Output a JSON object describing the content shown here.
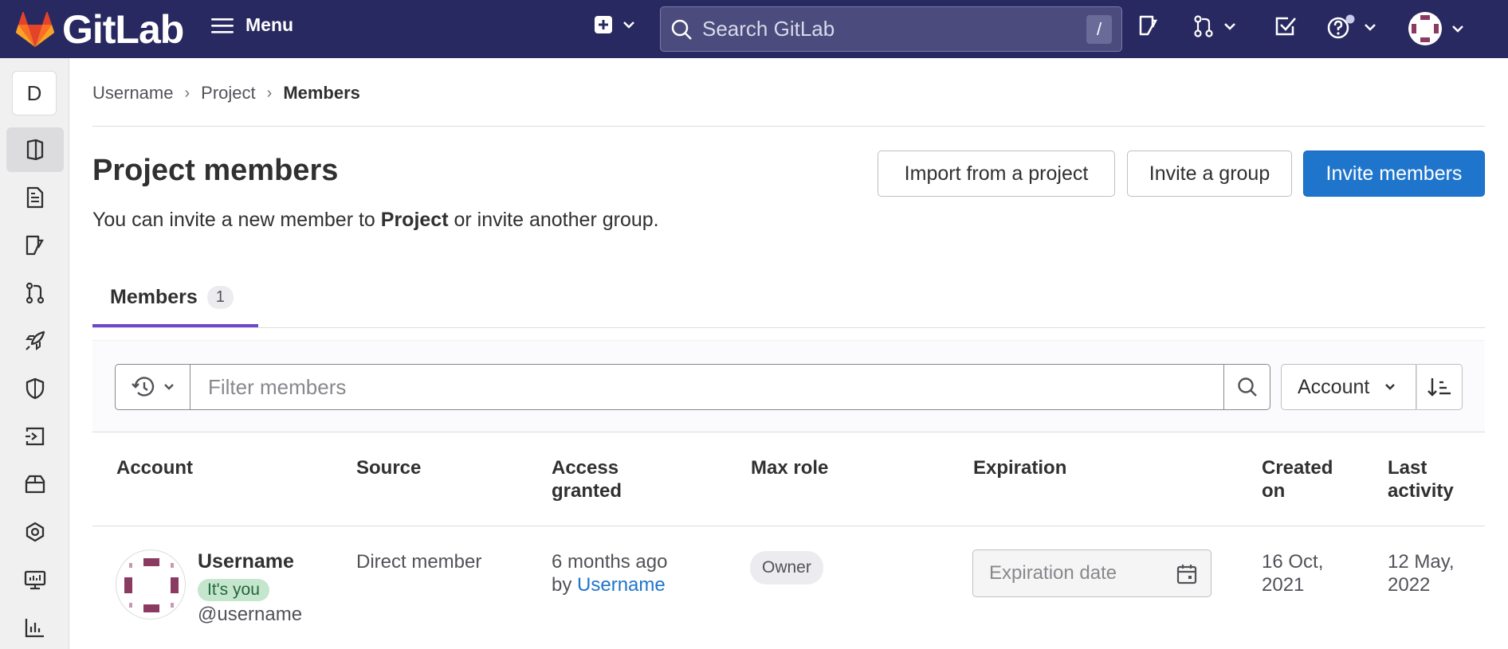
{
  "topbar": {
    "brand": "GitLab",
    "menu_label": "Menu",
    "search_placeholder": "Search GitLab",
    "search_shortcut": "/"
  },
  "sidebar": {
    "project_initial": "D",
    "items": [
      "project-overview",
      "repository",
      "issues",
      "merge-requests",
      "ci-cd",
      "security",
      "deployments",
      "packages",
      "infrastructure",
      "monitor",
      "analytics"
    ]
  },
  "breadcrumb": [
    "Username",
    "Project",
    "Members"
  ],
  "header": {
    "title": "Project members",
    "description_prefix": "You can invite a new member to ",
    "description_project": "Project",
    "description_suffix": " or invite another group."
  },
  "actions": {
    "import": "Import from a project",
    "invite_group": "Invite a group",
    "invite_members": "Invite members"
  },
  "tabs": [
    {
      "label": "Members",
      "count": "1"
    }
  ],
  "filter": {
    "placeholder": "Filter members",
    "sort_by": "Account"
  },
  "table": {
    "columns": [
      "Account",
      "Source",
      "Access granted",
      "Max role",
      "Expiration",
      "Created on",
      "Last activity"
    ],
    "rows": [
      {
        "name": "Username",
        "badge": "It's you",
        "handle": "@username",
        "source": "Direct member",
        "access_granted": "6 months ago",
        "access_by_prefix": "by",
        "access_by": "Username",
        "max_role": "Owner",
        "expiration_placeholder": "Expiration date",
        "created_on": "16 Oct, 2021",
        "last_activity": "12 May, 2022"
      }
    ]
  },
  "colors": {
    "topbar": "#292961",
    "primary": "#1f75cb",
    "tab_underline": "#6e49cb",
    "you_badge": "#c3e6cd"
  }
}
